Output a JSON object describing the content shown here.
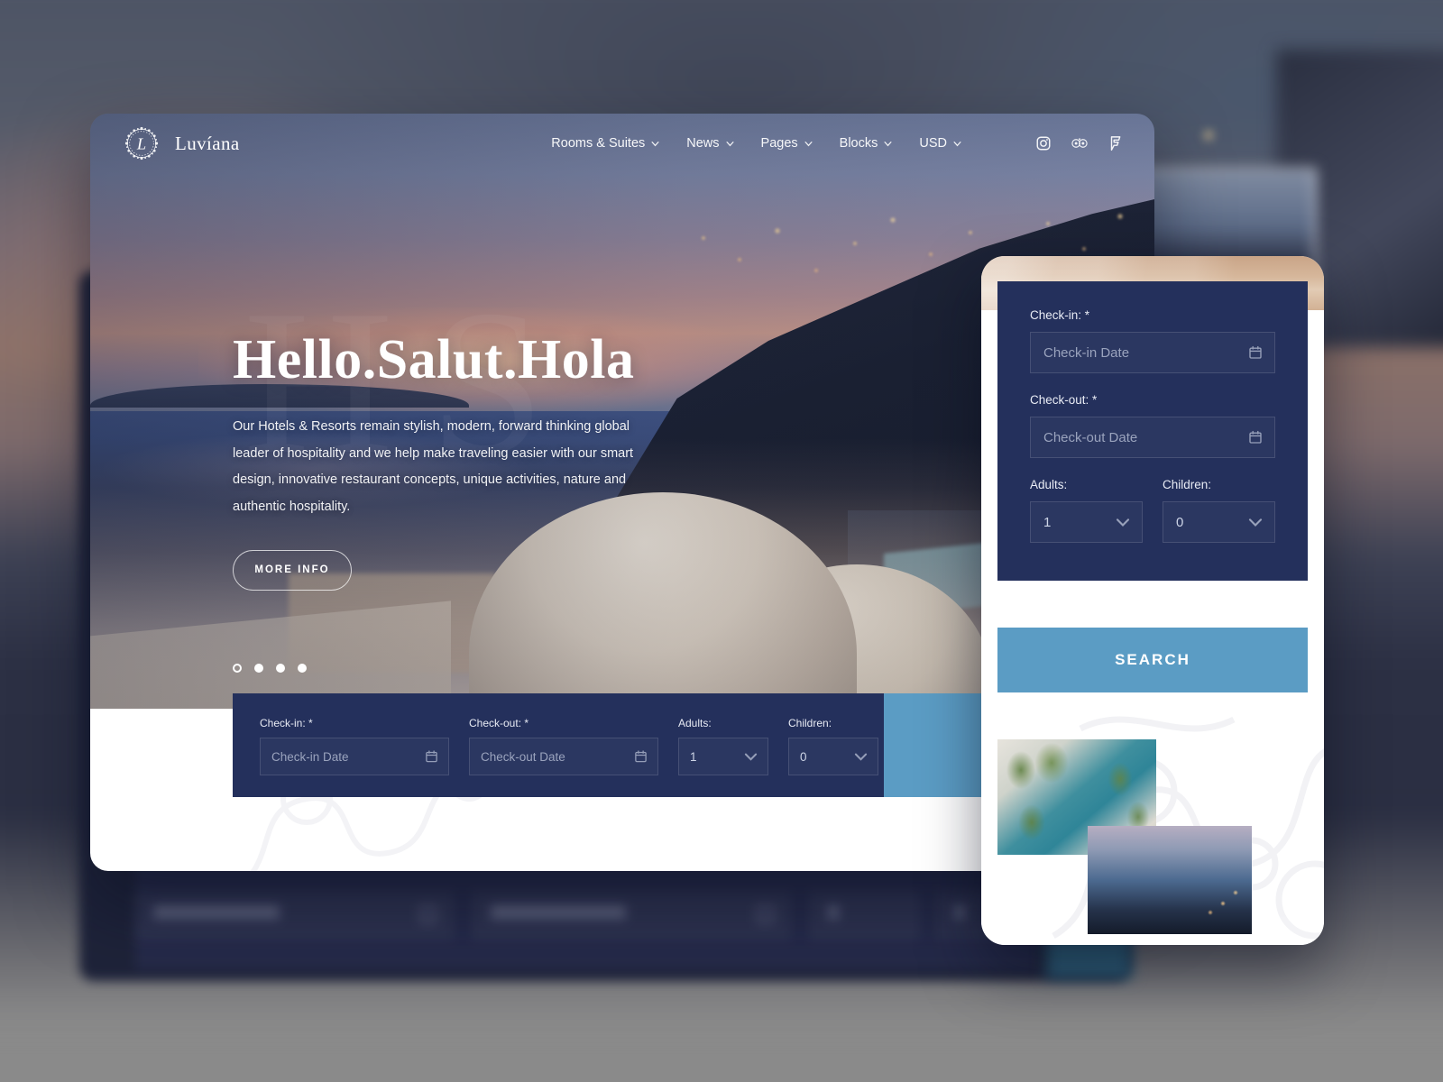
{
  "brand": {
    "name": "Luvíana",
    "logo_icon": "wreath-monogram-icon"
  },
  "nav": {
    "items": [
      {
        "label": "Rooms & Suites",
        "icon": "chevron-down-icon"
      },
      {
        "label": "News",
        "icon": "chevron-down-icon"
      },
      {
        "label": "Pages",
        "icon": "chevron-down-icon"
      },
      {
        "label": "Blocks",
        "icon": "chevron-down-icon"
      },
      {
        "label": "USD",
        "icon": "chevron-down-icon"
      }
    ],
    "social": [
      {
        "name": "instagram-icon"
      },
      {
        "name": "tripadvisor-icon"
      },
      {
        "name": "foursquare-icon"
      }
    ]
  },
  "hero": {
    "watermark": "HS",
    "title": "Hello.Salut.Hola",
    "subtitle": "Our Hotels & Resorts remain stylish, modern, forward thinking global leader of hospitality and we help make traveling easier with our smart design, innovative restaurant concepts, unique activities, nature and authentic hospitality.",
    "cta_label": "MORE INFO",
    "slider_dots": 4,
    "active_dot": 0,
    "thumbnails": [
      {
        "name": "thumb-sunset-coast",
        "active": true
      },
      {
        "name": "thumb-restaurant",
        "active": false
      },
      {
        "name": "thumb-suite-bedroom",
        "active": false
      },
      {
        "name": "thumb-infinity-pool",
        "active": false
      }
    ]
  },
  "booking": {
    "checkin_label": "Check-in:",
    "checkin_required": "*",
    "checkin_placeholder": "Check-in Date",
    "checkout_label": "Check-out:",
    "checkout_required": "*",
    "checkout_placeholder": "Check-out Date",
    "adults_label": "Adults:",
    "adults_value": "1",
    "children_label": "Children:",
    "children_value": "0",
    "search_label": "SEARCH",
    "calendar_icon": "calendar-icon",
    "select_icon": "chevron-down-icon"
  },
  "colors": {
    "form_navy": "#24305c",
    "search_blue": "#5b9cc4",
    "panel_white": "#ffffff",
    "page_gray": "#8a8a8a"
  }
}
